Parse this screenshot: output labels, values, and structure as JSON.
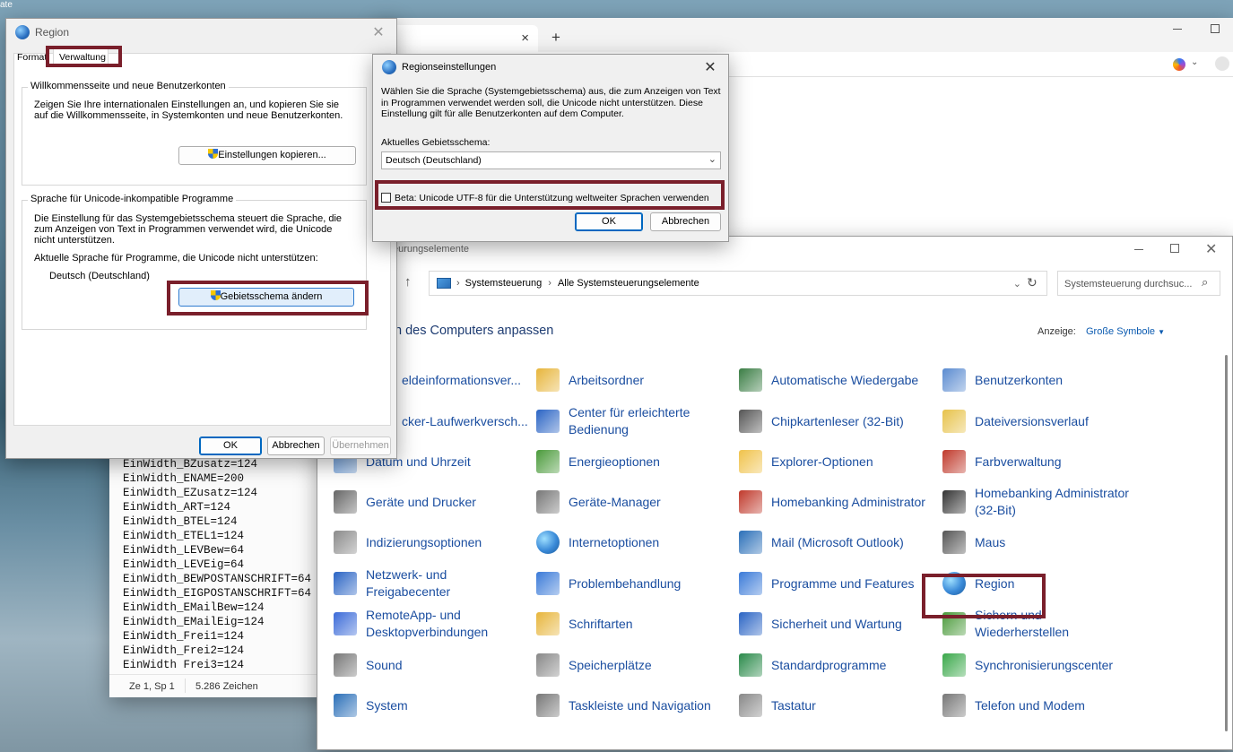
{
  "corner_text": "ate",
  "notepad": {
    "lines": [
      "EinWidth_BZusatz=124",
      "EinWidth_ENAME=200",
      "EinWidth_EZusatz=124",
      "EinWidth_ART=124",
      "EinWidth_BTEL=124",
      "EinWidth_ETEL1=124",
      "EinWidth_LEVBew=64",
      "EinWidth_LEVEig=64",
      "EinWidth_BEWPOSTANSCHRIFT=64",
      "EinWidth_EIGPOSTANSCHRIFT=64",
      "EinWidth_EMailBew=124",
      "EinWidth_EMailEig=124",
      "EinWidth_Frei1=124",
      "EinWidth_Frei2=124",
      "EinWidth_Frei3=124"
    ],
    "status_pos": "Ze 1, Sp 1",
    "status_chars": "5.286 Zeichen"
  },
  "browser": {
    "tab_close": "×",
    "new_tab": "+"
  },
  "control_panel": {
    "title": "eurungselemente",
    "breadcrumb": [
      "Systemsteuerung",
      "Alle Systemsteuerungselemente"
    ],
    "search_placeholder": "Systemsteuerung durchsuc...",
    "heading": "n des Computers anpassen",
    "view_label": "Anzeige:",
    "view_value": "Große Symbole",
    "items": [
      {
        "label": "eldeinformationsver...",
        "icon": "credential-icon"
      },
      {
        "label": "Arbeitsordner",
        "icon": "work-folders-icon"
      },
      {
        "label": "Automatische Wiedergabe",
        "icon": "autoplay-icon"
      },
      {
        "label": "Benutzerkonten",
        "icon": "user-accounts-icon"
      },
      {
        "label": "cker-Laufwerkversch...",
        "icon": "bitlocker-icon"
      },
      {
        "label": "Center für erleichterte Bedienung",
        "icon": "ease-of-access-icon"
      },
      {
        "label": "Chipkartenleser (32-Bit)",
        "icon": "smartcard-icon"
      },
      {
        "label": "Dateiversionsverlauf",
        "icon": "file-history-icon"
      },
      {
        "label": "Datum und Uhrzeit",
        "icon": "date-time-icon"
      },
      {
        "label": "Energieoptionen",
        "icon": "power-icon"
      },
      {
        "label": "Explorer-Optionen",
        "icon": "explorer-options-icon"
      },
      {
        "label": "Farbverwaltung",
        "icon": "color-management-icon"
      },
      {
        "label": "Geräte und Drucker",
        "icon": "printer-icon"
      },
      {
        "label": "Geräte-Manager",
        "icon": "device-manager-icon"
      },
      {
        "label": "Homebanking Administrator",
        "icon": "homebanking-icon"
      },
      {
        "label": "Homebanking Administrator (32-Bit)",
        "icon": "bank-icon"
      },
      {
        "label": "Indizierungsoptionen",
        "icon": "indexing-icon"
      },
      {
        "label": "Internetoptionen",
        "icon": "internet-options-icon"
      },
      {
        "label": "Mail (Microsoft Outlook)",
        "icon": "mail-icon"
      },
      {
        "label": "Maus",
        "icon": "mouse-icon"
      },
      {
        "label": "Netzwerk- und Freigabecenter",
        "icon": "network-icon"
      },
      {
        "label": "Problembehandlung",
        "icon": "troubleshoot-icon"
      },
      {
        "label": "Programme und Features",
        "icon": "programs-icon"
      },
      {
        "label": "Region",
        "icon": "region-icon"
      },
      {
        "label": "RemoteApp- und Desktopverbindungen",
        "icon": "remoteapp-icon"
      },
      {
        "label": "Schriftarten",
        "icon": "fonts-icon"
      },
      {
        "label": "Sicherheit und Wartung",
        "icon": "security-flag-icon"
      },
      {
        "label": "Sichern und Wiederherstellen",
        "icon": "backup-icon"
      },
      {
        "label": "Sound",
        "icon": "sound-icon"
      },
      {
        "label": "Speicherplätze",
        "icon": "storage-icon"
      },
      {
        "label": "Standardprogramme",
        "icon": "default-programs-icon"
      },
      {
        "label": "Synchronisierungscenter",
        "icon": "sync-icon"
      },
      {
        "label": "System",
        "icon": "system-icon"
      },
      {
        "label": "Taskleiste und Navigation",
        "icon": "taskbar-icon"
      },
      {
        "label": "Tastatur",
        "icon": "keyboard-icon"
      },
      {
        "label": "Telefon und Modem",
        "icon": "phone-modem-icon"
      }
    ]
  },
  "region_dialog": {
    "title": "Region",
    "tabs": [
      "Format",
      "Verwaltung"
    ],
    "group1_title": "Willkommensseite und neue Benutzerkonten",
    "group1_text": "Zeigen Sie Ihre internationalen Einstellungen an, und kopieren Sie sie auf die Willkommensseite, in Systemkonten und neue Benutzerkonten.",
    "copy_button": "Einstellungen kopieren...",
    "group2_title": "Sprache für Unicode-inkompatible Programme",
    "group2_text": "Die Einstellung für das Systemgebietsschema steuert die Sprache, die zum Anzeigen von Text in Programmen verwendet wird, die Unicode nicht unterstützen.",
    "current_label": "Aktuelle Sprache für Programme, die Unicode nicht unterstützen:",
    "current_value": "Deutsch (Deutschland)",
    "change_button": "Gebietsschema ändern",
    "ok": "OK",
    "cancel": "Abbrechen",
    "apply": "Übernehmen"
  },
  "regional_settings": {
    "title": "Regionseinstellungen",
    "text": "Wählen Sie die Sprache (Systemgebietsschema) aus, die zum Anzeigen von Text in Programmen verwendet werden soll, die Unicode nicht unterstützen. Diese Einstellung gilt für alle Benutzerkonten auf dem Computer.",
    "locale_label": "Aktuelles Gebietsschema:",
    "locale_value": "Deutsch (Deutschland)",
    "beta_label": "Beta: Unicode UTF-8 für die Unterstützung weltweiter Sprachen verwenden",
    "beta_checked": false,
    "ok": "OK",
    "cancel": "Abbrechen"
  },
  "colors": {
    "highlight": "#7a1f2b",
    "link": "#1b4ea0",
    "accent": "#0067c0"
  }
}
